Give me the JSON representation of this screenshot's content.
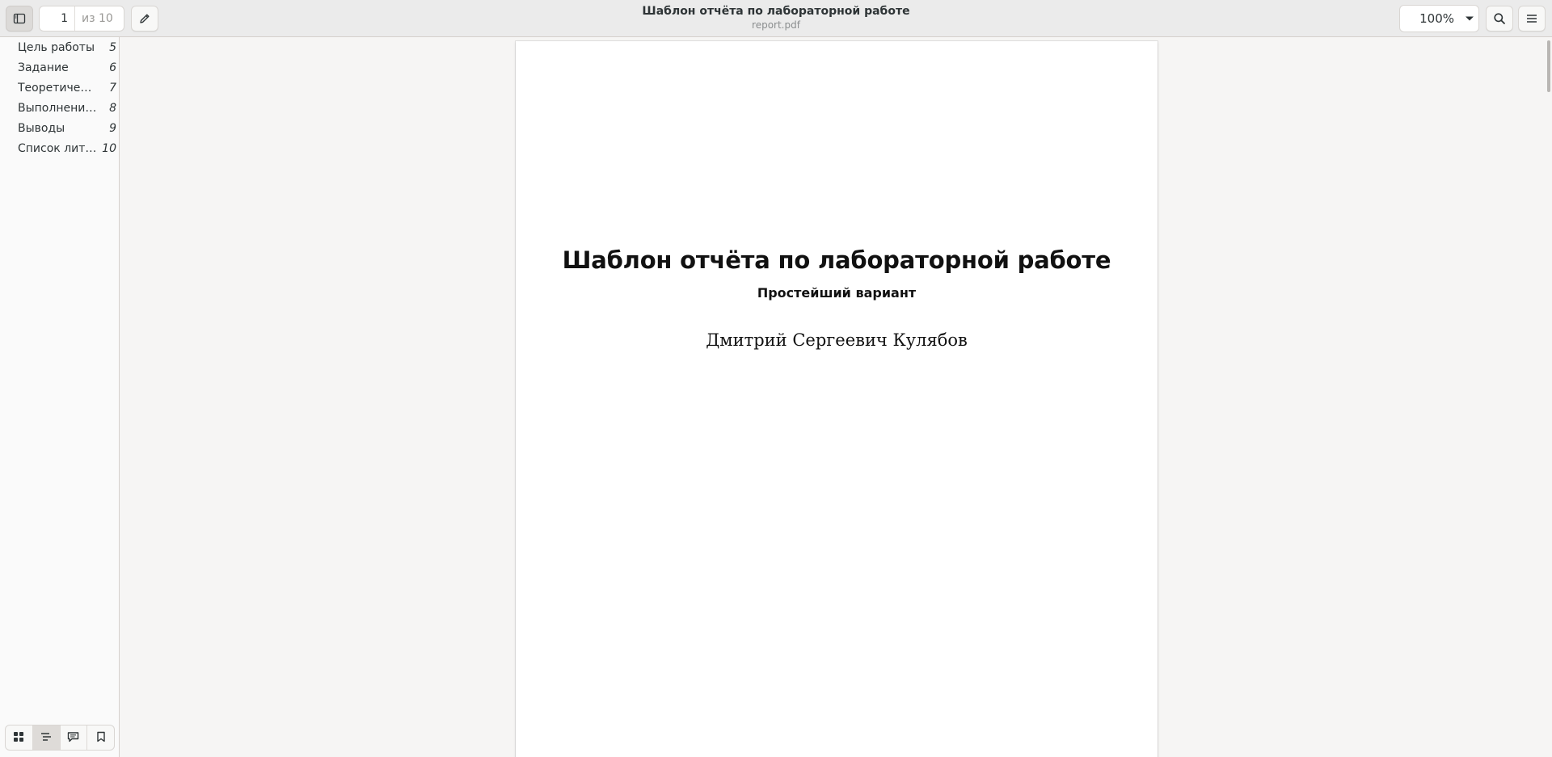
{
  "header": {
    "title": "Шаблон отчёта по лабораторной работе",
    "subtitle": "report.pdf",
    "page_current": "1",
    "page_total": "из 10",
    "zoom": "100%"
  },
  "icons": {
    "sidebar_toggle": "sidebar-toggle-icon",
    "annotate": "pencil-icon",
    "search": "search-icon",
    "menu": "hamburger-menu-icon",
    "zoom_dropdown": "chevron-down-icon"
  },
  "sidebar": {
    "outline": [
      {
        "label": "Цель работы",
        "page": "5"
      },
      {
        "label": "Задание",
        "page": "6"
      },
      {
        "label": "Теоретичес…",
        "page": "7"
      },
      {
        "label": "Выполнение…",
        "page": "8"
      },
      {
        "label": "Выводы",
        "page": "9"
      },
      {
        "label": "Список лите…",
        "page": "10"
      }
    ],
    "tabs": [
      {
        "name": "thumbnails",
        "icon": "grid-icon"
      },
      {
        "name": "outline",
        "icon": "outline-icon"
      },
      {
        "name": "annotations",
        "icon": "annotations-icon"
      },
      {
        "name": "bookmarks",
        "icon": "bookmark-icon"
      }
    ],
    "active_tab": "outline"
  },
  "document": {
    "title": "Шаблон отчёта по лабораторной работе",
    "subtitle": "Простейший вариант",
    "author": "Дмитрий Сергеевич Кулябов"
  }
}
